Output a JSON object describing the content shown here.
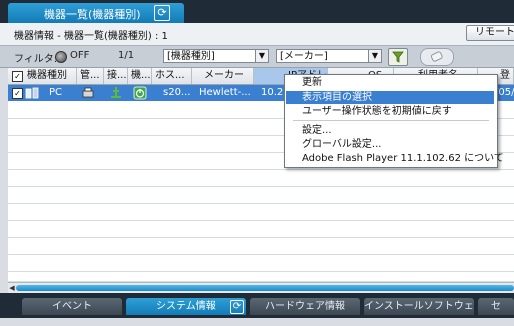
{
  "window": {
    "tab_title": "機器一覧(機器種別)",
    "header_title": "機器情報 - 機器一覧(機器種別) : 1",
    "remote_button": "リモートコ"
  },
  "filter": {
    "label": "フィルタ:",
    "state": "OFF",
    "page": "1/1",
    "combo1": "[機器種別]",
    "combo2": "[メーカー]"
  },
  "table": {
    "columns": [
      "機器種別",
      "管...",
      "接...",
      "機...",
      "ホス...",
      "メーカー",
      "IPアドレス",
      "OS",
      "利用者名",
      "登"
    ],
    "rows": [
      {
        "checked": true,
        "type": "PC",
        "host": "s20...",
        "maker": "Hewlett-...",
        "ip": "10.2",
        "date": "/05/"
      }
    ]
  },
  "context_menu": {
    "items": [
      {
        "label": "更新",
        "highlighted": false
      },
      {
        "label": "表示項目の選択",
        "highlighted": true
      },
      {
        "label": "ユーザー操作状態を初期値に戻す",
        "highlighted": false
      },
      {
        "label": "設定...",
        "highlighted": false
      },
      {
        "label": "グローバル設定...",
        "highlighted": false
      },
      {
        "label": "Adobe Flash Player 11.1.102.62 について",
        "highlighted": false
      }
    ]
  },
  "bottom_tabs": [
    {
      "label": "イベント",
      "active": false
    },
    {
      "label": "システム情報",
      "active": true
    },
    {
      "label": "ハードウェア情報",
      "active": false
    },
    {
      "label": "インストールソフトウェ...",
      "active": false
    },
    {
      "label": "セ",
      "active": false
    }
  ],
  "colors": {
    "accent": "#2f9fd6",
    "selection": "#3b80d0",
    "frame": "#1f2b36"
  },
  "icons": [
    "refresh-icon",
    "toggle-icon",
    "funnel-icon",
    "eraser-icon",
    "pc-icon",
    "printer-icon",
    "network-icon",
    "power-icon"
  ]
}
